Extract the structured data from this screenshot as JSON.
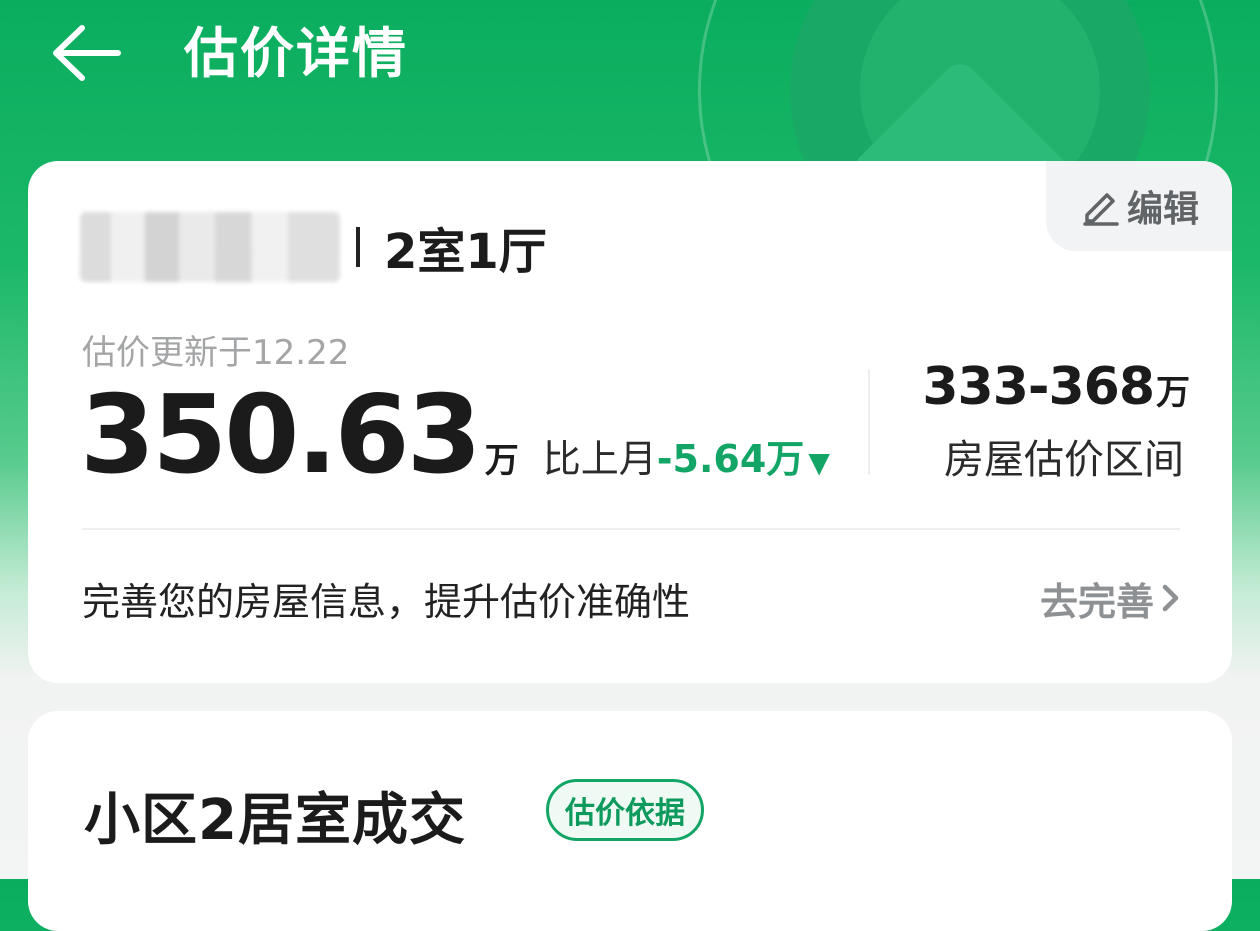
{
  "header": {
    "title": "估价详情",
    "back_icon": "arrow-left-icon"
  },
  "valuation_card": {
    "edit_label": "编辑",
    "edit_icon": "pencil-icon",
    "house_name_blurred": true,
    "house_layout": "2室1厅",
    "update_time": "估价更新于12.22",
    "price": "350.63",
    "price_unit": "万",
    "change_label": "比上月",
    "change_value": "-5.64万",
    "change_direction_icon": "triangle-down-icon",
    "range_value": "333-368",
    "range_unit": "万",
    "range_label": "房屋估价区间",
    "improve_text": "完善您的房屋信息，提升估价准确性",
    "improve_link": "去完善",
    "improve_icon": "chevron-right-icon"
  },
  "deals_card": {
    "title": "小区2居室成交",
    "tag": "估价依据"
  },
  "colors": {
    "brand_green": "#0aad5e",
    "decrease_green": "#12a566",
    "text_dark": "#1b1b1b",
    "text_muted": "#a3a5a7"
  }
}
